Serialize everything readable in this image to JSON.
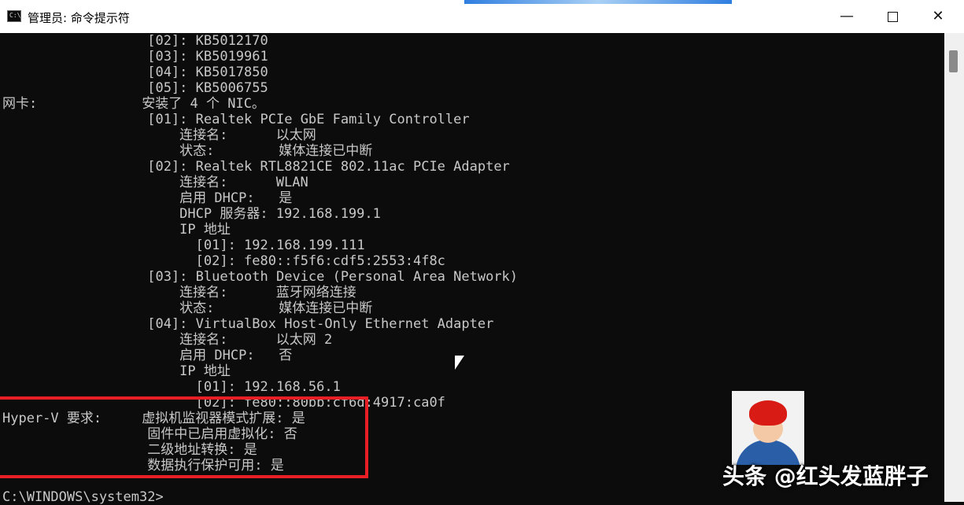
{
  "window": {
    "title": "管理员: 命令提示符",
    "icon": "cmd-icon",
    "icon_text": "C:\\_",
    "minimize_symbol": "—",
    "close_symbol": "✕"
  },
  "console_lines": [
    "                  [02]: KB5012170",
    "                  [03]: KB5019961",
    "                  [04]: KB5017850",
    "                  [05]: KB5006755",
    "网卡:             安装了 4 个 NIC。",
    "                  [01]: Realtek PCIe GbE Family Controller",
    "                      连接名:      以太网",
    "                      状态:        媒体连接已中断",
    "                  [02]: Realtek RTL8821CE 802.11ac PCIe Adapter",
    "                      连接名:      WLAN",
    "                      启用 DHCP:   是",
    "                      DHCP 服务器: 192.168.199.1",
    "                      IP 地址",
    "                        [01]: 192.168.199.111",
    "                        [02]: fe80::f5f6:cdf5:2553:4f8c",
    "                  [03]: Bluetooth Device (Personal Area Network)",
    "                      连接名:      蓝牙网络连接",
    "                      状态:        媒体连接已中断",
    "                  [04]: VirtualBox Host-Only Ethernet Adapter",
    "                      连接名:      以太网 2",
    "                      启用 DHCP:   否",
    "                      IP 地址",
    "                        [01]: 192.168.56.1",
    "                        [02]: fe80::80bb:cf6d:4917:ca0f",
    "Hyper-V 要求:     虚拟机监视器模式扩展: 是",
    "                  固件中已启用虚拟化: 否",
    "                  二级地址转换: 是",
    "                  数据执行保护可用: 是",
    "",
    "C:\\WINDOWS\\system32>"
  ],
  "watermark": "头条 @红头发蓝胖子",
  "colors": {
    "console_bg": "#0c0c0c",
    "console_text": "#c8c8c8",
    "highlight_border": "#e81e25"
  }
}
